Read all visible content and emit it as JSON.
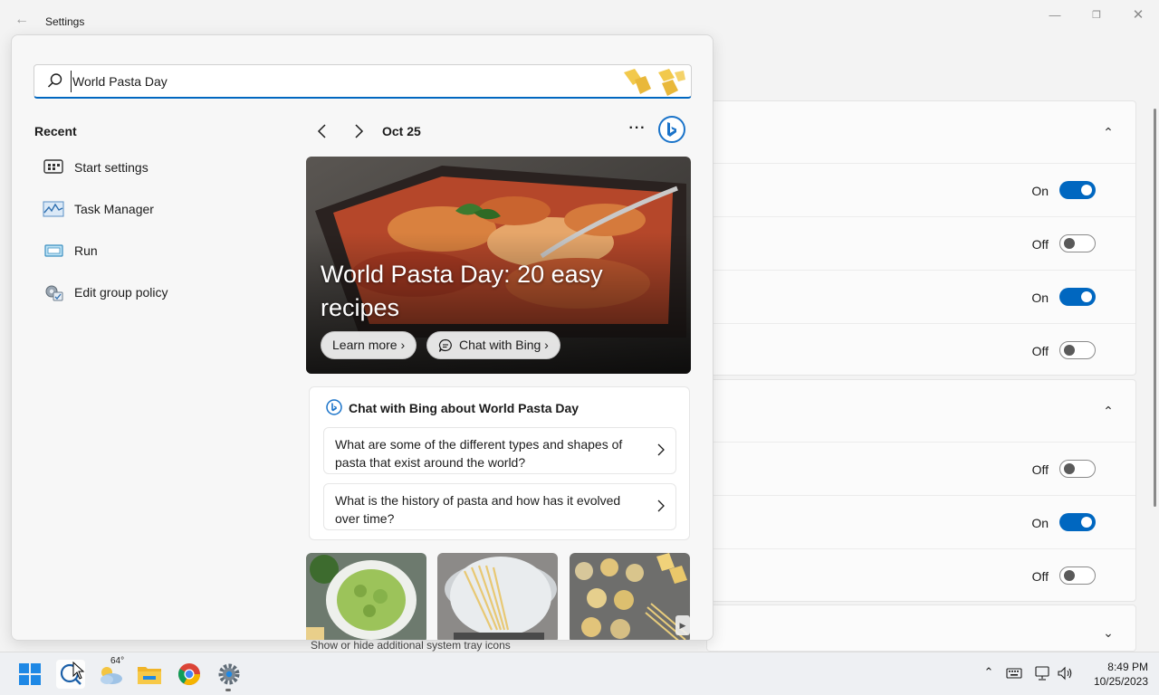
{
  "window": {
    "title": "Settings",
    "back_icon": "back-arrow-icon",
    "controls": [
      "minimize-icon",
      "maximize-icon",
      "close-icon"
    ]
  },
  "settings_rows": {
    "group1": [
      {
        "state": "On",
        "on": true
      },
      {
        "state": "Off",
        "on": false
      },
      {
        "state": "On",
        "on": true
      },
      {
        "state": "Off",
        "on": false
      }
    ],
    "group2": [
      {
        "state": "Off",
        "on": false
      },
      {
        "state": "On",
        "on": true
      },
      {
        "state": "Off",
        "on": false
      }
    ],
    "tray_hint": "Show or hide additional system tray icons"
  },
  "search": {
    "value": "World Pasta Day",
    "icon": "search-icon"
  },
  "recent": {
    "title": "Recent",
    "items": [
      {
        "label": "Start settings",
        "icon": "start-settings-icon"
      },
      {
        "label": "Task Manager",
        "icon": "task-manager-icon"
      },
      {
        "label": "Run",
        "icon": "run-icon"
      },
      {
        "label": "Edit group policy",
        "icon": "group-policy-icon"
      }
    ]
  },
  "highlights": {
    "date": "Oct 25",
    "more_label": "···",
    "hero": {
      "title": "World Pasta Day: 20 easy recipes",
      "learn_more": "Learn more",
      "chat_with_bing": "Chat with Bing"
    },
    "chat_card": {
      "title": "Chat with Bing about World Pasta Day",
      "prompts": [
        "What are some of the different types and shapes of pasta that exist around the world?",
        "What is the history of pasta and how has it evolved over time?"
      ]
    }
  },
  "taskbar": {
    "weather_temp": "64°",
    "time": "8:49 PM",
    "date": "10/25/2023"
  },
  "colors": {
    "accent": "#0067c0",
    "toggle_off_knob": "#5a5a5a"
  }
}
